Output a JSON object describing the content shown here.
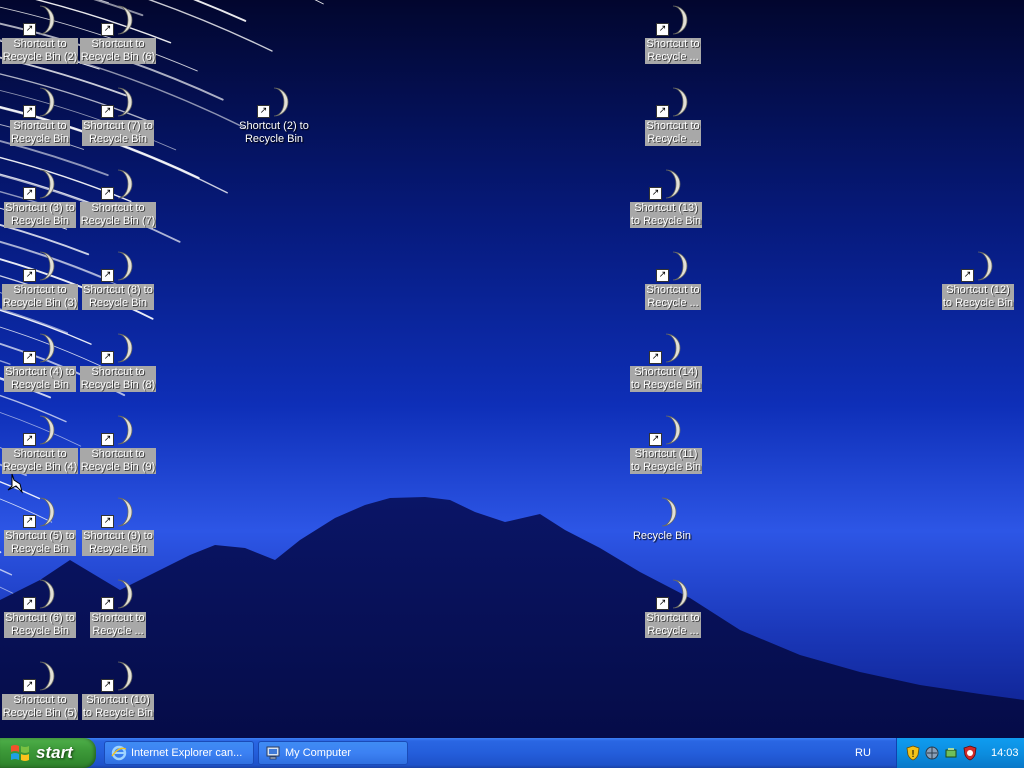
{
  "desktop_icons": [
    {
      "label": "Shortcut to\nRecycle Bin (2)",
      "shortcut": true,
      "selected": true
    },
    {
      "label": "Shortcut to\nRecycle Bin (6)",
      "shortcut": true,
      "selected": true
    },
    {
      "label": "Shortcut to\nRecycle ...",
      "shortcut": true,
      "selected": true
    },
    {
      "label": "Shortcut to\nRecycle Bin",
      "shortcut": true,
      "selected": true
    },
    {
      "label": "Shortcut (7) to\nRecycle Bin",
      "shortcut": true,
      "selected": true
    },
    {
      "label": "Shortcut (2) to\nRecycle Bin",
      "shortcut": true,
      "selected": false
    },
    {
      "label": "Shortcut to\nRecycle ...",
      "shortcut": true,
      "selected": true
    },
    {
      "label": "Shortcut (3) to\nRecycle Bin",
      "shortcut": true,
      "selected": true
    },
    {
      "label": "Shortcut to\nRecycle Bin (7)",
      "shortcut": true,
      "selected": true
    },
    {
      "label": "Shortcut (13)\nto Recycle Bin",
      "shortcut": true,
      "selected": true
    },
    {
      "label": "Shortcut to\nRecycle Bin (3)",
      "shortcut": true,
      "selected": true
    },
    {
      "label": "Shortcut (8) to\nRecycle Bin",
      "shortcut": true,
      "selected": true
    },
    {
      "label": "Shortcut to\nRecycle ...",
      "shortcut": true,
      "selected": true
    },
    {
      "label": "Shortcut (12)\nto Recycle Bin",
      "shortcut": true,
      "selected": true
    },
    {
      "label": "Shortcut (4) to\nRecycle Bin",
      "shortcut": true,
      "selected": true
    },
    {
      "label": "Shortcut to\nRecycle Bin (8)",
      "shortcut": true,
      "selected": true
    },
    {
      "label": "Shortcut (14)\nto Recycle Bin",
      "shortcut": true,
      "selected": true
    },
    {
      "label": "Shortcut to\nRecycle Bin (4)",
      "shortcut": true,
      "selected": true
    },
    {
      "label": "Shortcut to\nRecycle Bin (9)",
      "shortcut": true,
      "selected": true
    },
    {
      "label": "Shortcut (11)\nto Recycle Bin",
      "shortcut": true,
      "selected": true
    },
    {
      "label": "Shortcut (5) to\nRecycle Bin",
      "shortcut": true,
      "selected": true
    },
    {
      "label": "Shortcut (9) to\nRecycle Bin",
      "shortcut": true,
      "selected": true
    },
    {
      "label": "Recycle Bin",
      "shortcut": false,
      "selected": false
    },
    {
      "label": "Shortcut (6) to\nRecycle Bin",
      "shortcut": true,
      "selected": true
    },
    {
      "label": "Shortcut to\nRecycle ...",
      "shortcut": true,
      "selected": true
    },
    {
      "label": "Shortcut to\nRecycle ...",
      "shortcut": true,
      "selected": true
    },
    {
      "label": "Shortcut to\nRecycle Bin (5)",
      "shortcut": true,
      "selected": true
    },
    {
      "label": "Shortcut (10)\nto Recycle Bin",
      "shortcut": true,
      "selected": true
    }
  ],
  "taskbar": {
    "start_label": "start",
    "tasks": [
      {
        "label": "Internet Explorer can...",
        "icon": "internet-explorer-icon"
      },
      {
        "label": "My Computer",
        "icon": "my-computer-icon"
      }
    ],
    "language": "RU",
    "clock": "14:03",
    "tray_icons": [
      "security-shield-icon",
      "network-icon",
      "safely-remove-hardware-icon",
      "antivirus-shield-icon"
    ]
  },
  "colors": {
    "taskbar_blue": "#245edb",
    "start_green": "#3d9a39",
    "tray_blue": "#0c8ee0",
    "selection_gray": "#a8a8a8"
  }
}
